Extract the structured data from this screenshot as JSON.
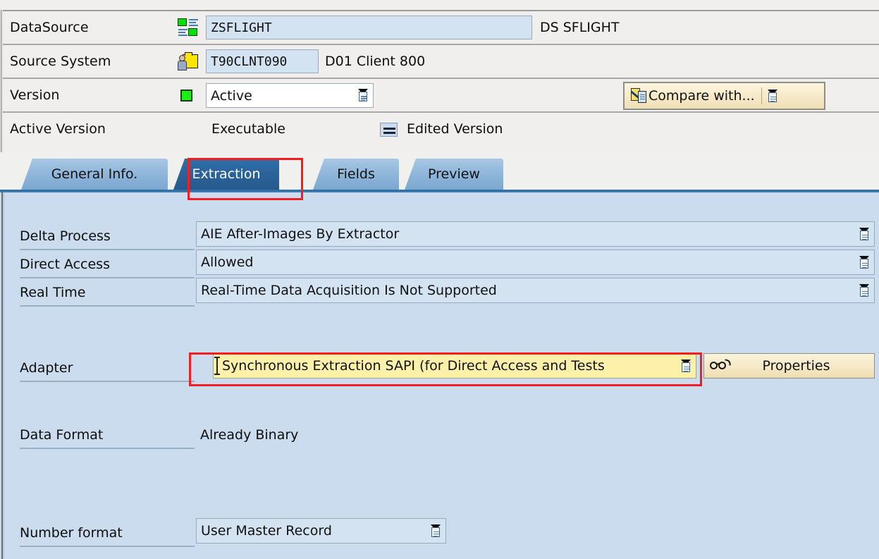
{
  "header": {
    "rows": [
      {
        "label": "DataSource",
        "icon": "datasource-grid-icon",
        "value": "ZSFLIGHT",
        "suffix": "DS SFLIGHT"
      },
      {
        "label": "Source System",
        "icon": "source-system-person-folder-icon",
        "value": "T90CLNT090",
        "suffix": "D01 Client 800"
      },
      {
        "label": "Version",
        "icon": "green-status-square-icon",
        "value": "Active"
      }
    ],
    "status_row": {
      "active_version_label": "Active Version",
      "executable_label": "Executable",
      "edited_version_label": "Edited Version",
      "edited_version_icon": "equals-icon"
    },
    "compare_button": {
      "label": "Compare with...",
      "icon": "compare-documents-icon",
      "dropdown_icon": "dropdown-icon"
    }
  },
  "tabs": [
    {
      "label": "General Info.",
      "active": false
    },
    {
      "label": "Extraction",
      "active": true
    },
    {
      "label": "Fields",
      "active": false
    },
    {
      "label": "Preview",
      "active": false
    }
  ],
  "extraction": {
    "fields": [
      {
        "label": "Delta Process",
        "value": "AIE After-Images By Extractor",
        "dropdown": true
      },
      {
        "label": "Direct Access",
        "value": "Allowed",
        "dropdown": true
      },
      {
        "label": "Real Time",
        "value": "Real-Time Data Acquisition Is Not Supported",
        "dropdown": true
      }
    ],
    "adapter": {
      "label": "Adapter",
      "value": "Synchronous Extraction SAPI (for Direct Access and Tests",
      "dropdown": true,
      "properties_button": {
        "label": "Properties",
        "icon": "glasses-icon"
      }
    },
    "data_format": {
      "label": "Data Format",
      "value": "Already Binary"
    },
    "number_format": {
      "label": "Number format",
      "value": "User Master Record",
      "dropdown": true
    }
  },
  "annotations": [
    {
      "name": "extraction-tab-highlight"
    },
    {
      "name": "adapter-field-highlight"
    }
  ],
  "colors": {
    "accent_blue": "#2f6fa8",
    "panel_bg": "#cbdcee",
    "field_bg": "#d4e3f2",
    "highlight_yellow": "#fdf0a8",
    "annotation_red": "#f51d1d",
    "button_cream": "#f4e7c4"
  }
}
